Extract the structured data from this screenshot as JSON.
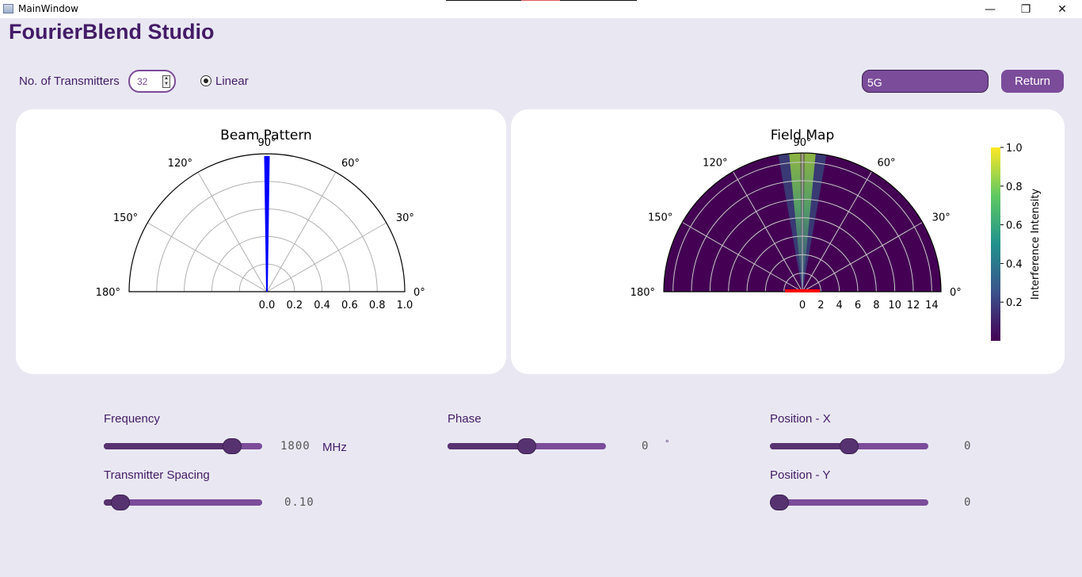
{
  "window": {
    "title": "MainWindow",
    "controls": [
      "—",
      "❐",
      "✕"
    ]
  },
  "app": {
    "title": "FourierBlend Studio"
  },
  "controls": {
    "transmitters_label": "No. of Transmitters",
    "transmitters_value": "32",
    "linear_label": "Linear",
    "mode_value": "5G",
    "return_label": "Return"
  },
  "beam_pattern": {
    "title": "Beam Pattern",
    "angle_labels": [
      "0°",
      "30°",
      "60°",
      "90°",
      "120°",
      "150°",
      "180°"
    ],
    "r_labels": [
      "0.0",
      "0.2",
      "0.4",
      "0.6",
      "0.8",
      "1.0"
    ],
    "beam_color": "#0000ff"
  },
  "field_map": {
    "title": "Field Map",
    "angle_labels": [
      "0°",
      "30°",
      "60°",
      "90°",
      "120°",
      "150°",
      "180°"
    ],
    "r_labels": [
      "0",
      "2",
      "4",
      "6",
      "8",
      "10",
      "12",
      "14"
    ],
    "colorbar_label": "Interference Intensity",
    "colorbar_ticks": [
      "1.0",
      "0.8",
      "0.6",
      "0.4",
      "0.2"
    ],
    "array_color": "#ff0000"
  },
  "sliders": {
    "frequency": {
      "label": "Frequency",
      "value": "1800",
      "unit": "MHz",
      "level": 0.85
    },
    "phase": {
      "label": "Phase",
      "value": "0",
      "unit": "°",
      "level": 0.5
    },
    "position_x": {
      "label": "Position - X",
      "value": "0",
      "level": 0.5
    },
    "spacing": {
      "label": "Transmitter Spacing",
      "value": "0.10",
      "level": 0.05
    },
    "position_y": {
      "label": "Position - Y",
      "value": "0",
      "level": 0.0
    }
  },
  "colors": {
    "accent": "#7b4c9a",
    "accent_dark": "#573270",
    "title_text": "#431b66",
    "background": "#e9e8f2"
  }
}
